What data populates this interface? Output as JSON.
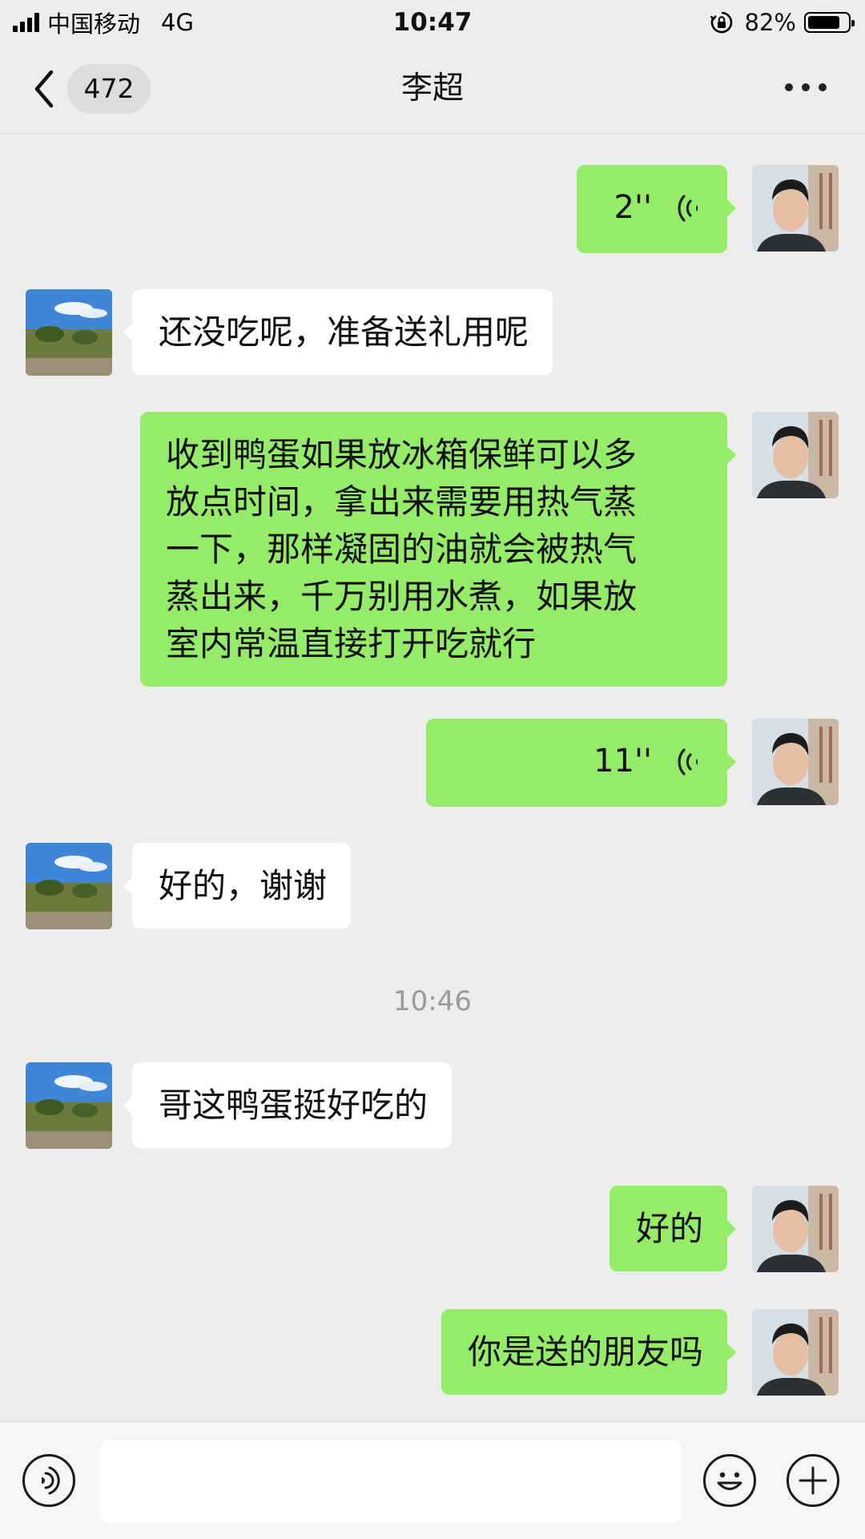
{
  "status_bar": {
    "carrier": "中国移动",
    "network": "4G",
    "time": "10:47",
    "battery_percent": "82%",
    "battery_level": 0.82
  },
  "nav": {
    "unread_count": "472",
    "title": "李超",
    "back_icon": "chevron-left-icon",
    "more_icon": "more-dots-icon"
  },
  "messages": [
    {
      "from": "me",
      "type": "voice",
      "duration": "2''"
    },
    {
      "from": "them",
      "type": "text",
      "text": "还没吃呢，准备送礼用呢"
    },
    {
      "from": "me",
      "type": "text",
      "lines": [
        "收到鸭蛋如果放冰箱保鲜可以多",
        "放点时间，拿出来需要用热气蒸",
        "一下，那样凝固的油就会被热气",
        "蒸出来，千万别用水煮，如果放",
        "室内常温直接打开吃就行"
      ]
    },
    {
      "from": "me",
      "type": "voice",
      "duration": "11''"
    },
    {
      "from": "them",
      "type": "text",
      "text": "好的，谢谢"
    },
    {
      "from": "them",
      "type": "text",
      "text": "哥这鸭蛋挺好吃的"
    },
    {
      "from": "me",
      "type": "text",
      "text": "好的"
    },
    {
      "from": "me",
      "type": "text",
      "text": "你是送的朋友吗"
    }
  ],
  "time_separator": "10:46",
  "input_bar": {
    "voice_icon": "voice-input-icon",
    "emoji_icon": "emoji-icon",
    "plus_icon": "plus-icon"
  },
  "colors": {
    "background": "#ededed",
    "outgoing_bubble": "#95ec69",
    "incoming_bubble": "#ffffff"
  }
}
